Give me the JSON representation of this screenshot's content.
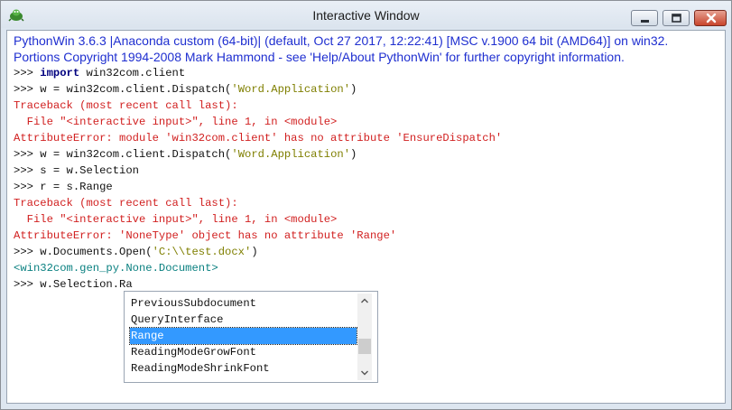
{
  "window": {
    "title": "Interactive Window"
  },
  "banner": {
    "line1": "PythonWin 3.6.3 |Anaconda custom (64-bit)| (default, Oct 27 2017, 12:22:41) [MSC v.1900 64 bit (AMD64)] on win32.",
    "line2": "Portions Copyright 1994-2008 Mark Hammond - see 'Help/About PythonWin' for further copyright information."
  },
  "console": {
    "prompt": ">>> ",
    "import_kw": "import",
    "import_module": " win32com.client",
    "dispatch_prefix": "w = win32com.client.Dispatch(",
    "dispatch_arg": "'Word.Application'",
    "close_paren": ")",
    "traceback_header": "Traceback (most recent call last):",
    "traceback_file": "  File \"<interactive input>\", line 1, in <module>",
    "error1": "AttributeError: module 'win32com.client' has no attribute 'EnsureDispatch'",
    "selection_cmd": "s = w.Selection",
    "range_cmd": "r = s.Range",
    "error2": "AttributeError: 'NoneType' object has no attribute 'Range'",
    "open_prefix": "w.Documents.Open(",
    "open_arg": "'C:\\\\test.docx'",
    "result": "<win32com.gen_py.None.Document>",
    "current_input": "w.Selection.Ra"
  },
  "autocomplete": {
    "items": [
      "PreviousSubdocument",
      "QueryInterface",
      "Range",
      "ReadingModeGrowFont",
      "ReadingModeShrinkFont"
    ],
    "selected": "Range"
  },
  "colors": {
    "banner_text": "#1f2fd0",
    "error_text": "#d11f1f",
    "result_text": "#0a8080",
    "keyword": "#00007f",
    "string_literal": "#7f7f00",
    "selection_highlight": "#3399ff"
  },
  "icons": {
    "app": "pythonwin-icon",
    "minimize": "minimize-icon",
    "maximize": "maximize-icon",
    "close": "close-icon",
    "scroll_up": "chevron-up-icon",
    "scroll_down": "chevron-down-icon"
  }
}
